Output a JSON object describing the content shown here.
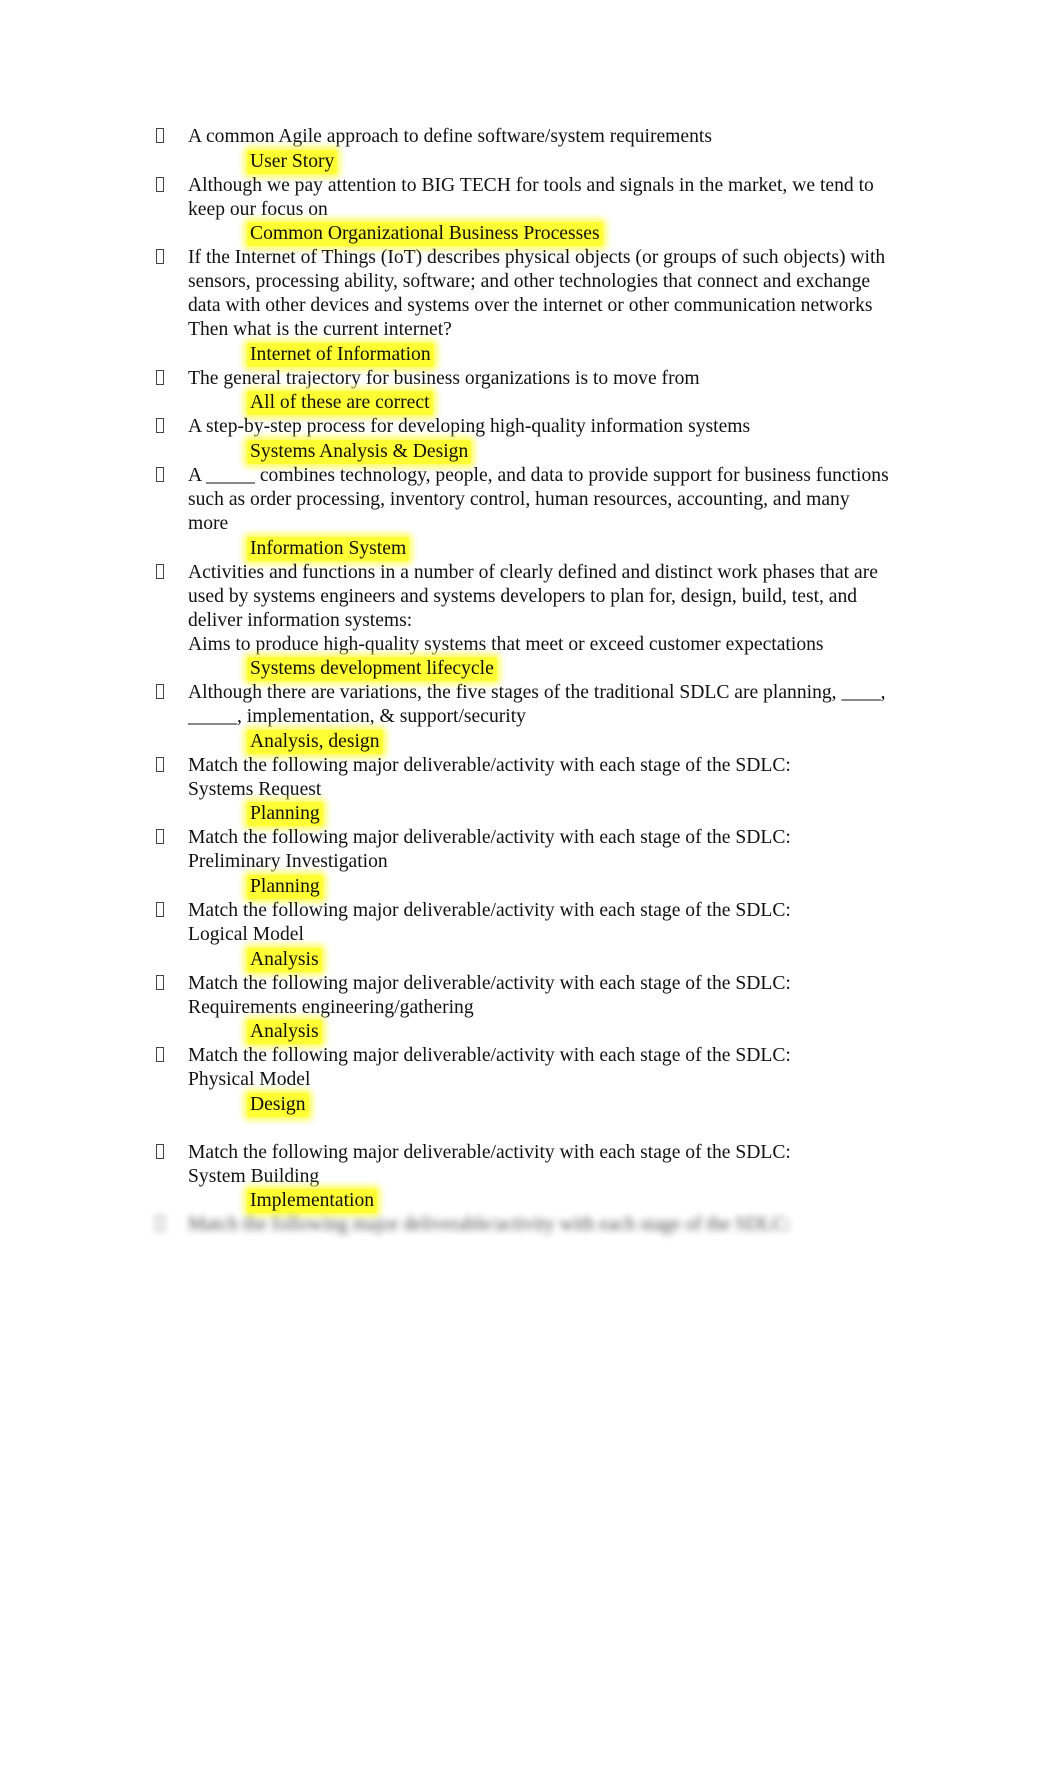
{
  "document": {
    "items": [
      {
        "question_lines": [
          "A common Agile approach to define software/system requirements"
        ],
        "answer": "User Story"
      },
      {
        "question_lines": [
          "Although we pay attention to BIG TECH for tools and signals in the market, we tend to",
          "keep our focus on"
        ],
        "answer": "Common Organizational Business Processes"
      },
      {
        "question_lines": [
          "If the Internet of Things (IoT) describes physical objects (or groups of such objects) with",
          "sensors, processing ability, software; and other technologies that connect and exchange",
          "data with other devices and systems over the internet or other communication networks",
          "Then what is the current internet?"
        ],
        "answer": "Internet of Information"
      },
      {
        "question_lines": [
          "The general trajectory for business organizations is to move from"
        ],
        "answer": "All of these are correct"
      },
      {
        "question_lines": [
          "A step-by-step process for developing high-quality information systems"
        ],
        "answer": "Systems Analysis & Design"
      },
      {
        "question_lines": [
          "A _____ combines technology, people, and data to provide support for business functions",
          "such as order processing, inventory control, human resources, accounting, and many",
          "more"
        ],
        "answer": "Information System"
      },
      {
        "question_lines": [
          "Activities and functions in a number of clearly defined and distinct work phases that are",
          "used by systems engineers and systems developers to plan for, design, build, test, and",
          "deliver information systems:",
          "Aims to produce high-quality systems that meet or exceed customer expectations"
        ],
        "answer": "Systems development lifecycle"
      },
      {
        "question_lines": [
          "Although there are variations, the five stages of the traditional SDLC are planning, ____,",
          "_____, implementation, & support/security"
        ],
        "answer": "Analysis, design"
      },
      {
        "question_lines": [
          "Match the following major deliverable/activity with each stage of the SDLC:",
          "Systems Request"
        ],
        "answer": "Planning"
      },
      {
        "question_lines": [
          "Match the following major deliverable/activity with each stage of the SDLC:",
          "Preliminary Investigation"
        ],
        "answer": "Planning"
      },
      {
        "question_lines": [
          "Match the following major deliverable/activity with each stage of the SDLC:",
          "Logical Model"
        ],
        "answer": "Analysis"
      },
      {
        "question_lines": [
          "Match the following major deliverable/activity with each stage of the SDLC:",
          "Requirements engineering/gathering"
        ],
        "answer": "Analysis"
      },
      {
        "question_lines": [
          "Match the following major deliverable/activity with each stage of the SDLC:",
          "Physical Model"
        ],
        "answer": "Design",
        "trailing_blank": true
      },
      {
        "question_lines": [
          "Match the following major deliverable/activity with each stage of the SDLC:",
          "System Building"
        ],
        "answer": "Implementation"
      },
      {
        "question_lines": [
          "Match the following major deliverable/activity with each stage of the SDLC:"
        ],
        "answer": null,
        "blurred": true
      }
    ]
  }
}
